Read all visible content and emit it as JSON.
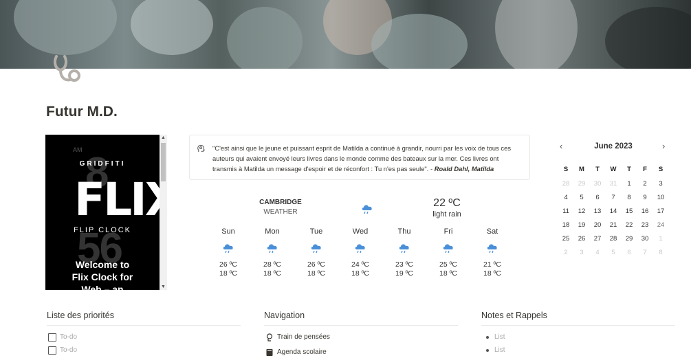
{
  "page": {
    "title": "Futur M.D."
  },
  "embed": {
    "am": "AM",
    "brand": "GRIDFITI",
    "logo": "FLIX",
    "subtitle": "FLIP CLOCK",
    "bg_hour": "8",
    "bg_minute": "56",
    "welcome_line1": "Welcome to",
    "welcome_line2": "Flix Clock for",
    "welcome_line3": "Web – an"
  },
  "quote": {
    "text": "\"C'est ainsi que le jeune et puissant esprit de Matilda a continué à grandir, nourri par les voix de tous ces auteurs qui avaient envoyé leurs livres dans le monde comme des bateaux sur la mer. Ces livres ont transmis à Matilda un message d'espoir et de réconfort : Tu n'es pas seule\". - ",
    "author": "Roald Dahl, Matilda"
  },
  "weather": {
    "city": "CAMBRIDGE",
    "label": "WEATHER",
    "current_temp": "22 ºC",
    "current_condition": "light rain",
    "icon": "rain-cloud-icon",
    "days": [
      {
        "name": "Sun",
        "high": "26 ºC",
        "low": "18 ºC"
      },
      {
        "name": "Mon",
        "high": "28 ºC",
        "low": "18 ºC"
      },
      {
        "name": "Tue",
        "high": "26 ºC",
        "low": "18 ºC"
      },
      {
        "name": "Wed",
        "high": "24 ºC",
        "low": "18 ºC"
      },
      {
        "name": "Thu",
        "high": "23 ºC",
        "low": "19 ºC"
      },
      {
        "name": "Fri",
        "high": "25 ºC",
        "low": "18 ºC"
      },
      {
        "name": "Sat",
        "high": "21 ºC",
        "low": "18 ºC"
      }
    ]
  },
  "calendar": {
    "month": "June 2023",
    "prev": "‹",
    "next": "›",
    "weekdays": [
      "S",
      "M",
      "T",
      "W",
      "T",
      "F",
      "S"
    ],
    "weeks": [
      [
        "28",
        "29",
        "30",
        "31",
        "1",
        "2",
        "3"
      ],
      [
        "4",
        "5",
        "6",
        "7",
        "8",
        "9",
        "10"
      ],
      [
        "11",
        "12",
        "13",
        "14",
        "15",
        "16",
        "17"
      ],
      [
        "18",
        "19",
        "20",
        "21",
        "22",
        "23",
        "24"
      ],
      [
        "25",
        "26",
        "27",
        "28",
        "29",
        "30",
        "1"
      ],
      [
        "2",
        "3",
        "4",
        "5",
        "6",
        "7",
        "8"
      ]
    ]
  },
  "priorities": {
    "title": "Liste des priorités",
    "items": [
      "To-do",
      "To-do"
    ]
  },
  "navigation": {
    "title": "Navigation",
    "items": [
      "Train de pensées",
      "Agenda scolaire"
    ]
  },
  "notes": {
    "title": "Notes et Rappels",
    "items": [
      "List",
      "List"
    ]
  },
  "colors": {
    "accent_cloud": "#4a90d9",
    "text": "#37352f"
  }
}
